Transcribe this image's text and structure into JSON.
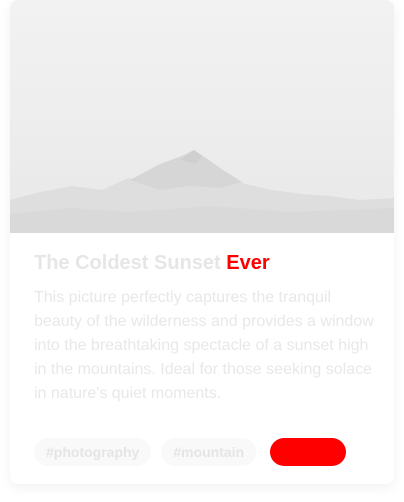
{
  "card": {
    "title_main": "The Coldest Sunset",
    "title_accent": "Ever",
    "description": "This picture perfectly captures the tranquil beauty of the wilderness and provides a window into the breathtaking spectacle of a sunset high in the mountains. Ideal for those seeking solace in nature's quiet moments.",
    "tags": [
      "#photography",
      "#mountain"
    ],
    "image_icon": "mountain-landscape",
    "accent_color": "#ff0000"
  }
}
